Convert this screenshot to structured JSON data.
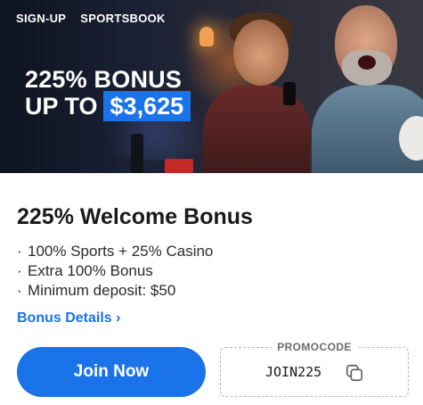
{
  "banner": {
    "tags": [
      "SIGN-UP",
      "SPORTSBOOK"
    ],
    "headline_line1": "225% BONUS",
    "headline_line2_prefix": "UP TO",
    "headline_amount": "$3,625",
    "accent_color": "#1a73e8",
    "image_description_icons": [
      "fans-celebrating-image"
    ]
  },
  "offer": {
    "title": "225% Welcome Bonus",
    "bullets": [
      "100% Sports + 25% Casino",
      "Extra 100% Bonus",
      "Minimum deposit: $50"
    ],
    "bullet_marker": "·",
    "details_link": "Bonus Details ›"
  },
  "actions": {
    "join_label": "Join Now",
    "promo_label": "PROMOCODE",
    "promo_code": "JOIN225",
    "copy_icon": "copy-icon"
  }
}
